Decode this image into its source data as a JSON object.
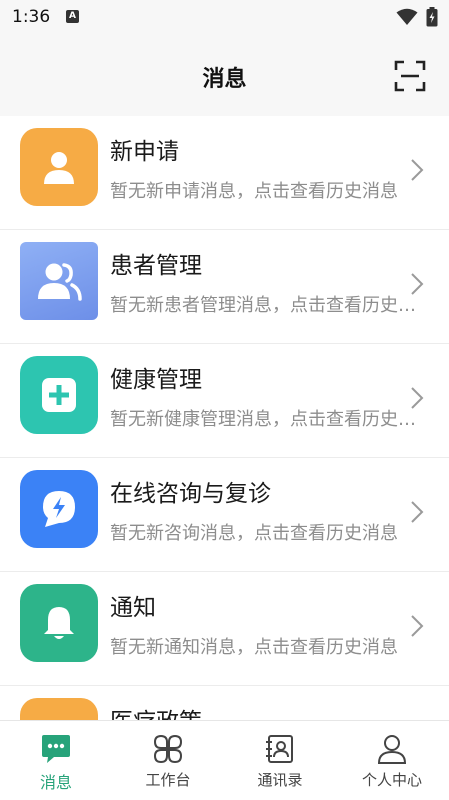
{
  "status_bar": {
    "time": "1:36",
    "notification_icon": "a-icon"
  },
  "header": {
    "title": "消息",
    "scan_icon": "scan-icon"
  },
  "messages": [
    {
      "title": "新申请",
      "subtitle": "暂无新申请消息，点击查看历史消息",
      "icon": "person-icon",
      "color": "#f6ab45"
    },
    {
      "title": "患者管理",
      "subtitle": "暂无新患者管理消息，点击查看历史消息",
      "icon": "patients-icon",
      "color": "#7d9ff0"
    },
    {
      "title": "健康管理",
      "subtitle": "暂无新健康管理消息，点击查看历史消息",
      "icon": "health-plus-icon",
      "color": "#2dc5b0"
    },
    {
      "title": "在线咨询与复诊",
      "subtitle": "暂无新咨询消息，点击查看历史消息",
      "icon": "consult-icon",
      "color": "#3b82f6"
    },
    {
      "title": "通知",
      "subtitle": "暂无新通知消息，点击查看历史消息",
      "icon": "bell-icon",
      "color": "#2db48a"
    },
    {
      "title": "医疗政策",
      "subtitle": "",
      "icon": "policy-icon",
      "color": "#f6ab45"
    }
  ],
  "tabs": [
    {
      "label": "消息",
      "icon": "message-icon",
      "active": true
    },
    {
      "label": "工作台",
      "icon": "workbench-icon",
      "active": false
    },
    {
      "label": "通讯录",
      "icon": "contacts-icon",
      "active": false
    },
    {
      "label": "个人中心",
      "icon": "profile-icon",
      "active": false
    }
  ],
  "colors": {
    "accent": "#27a37a",
    "subtitle": "#8d8d8d"
  }
}
